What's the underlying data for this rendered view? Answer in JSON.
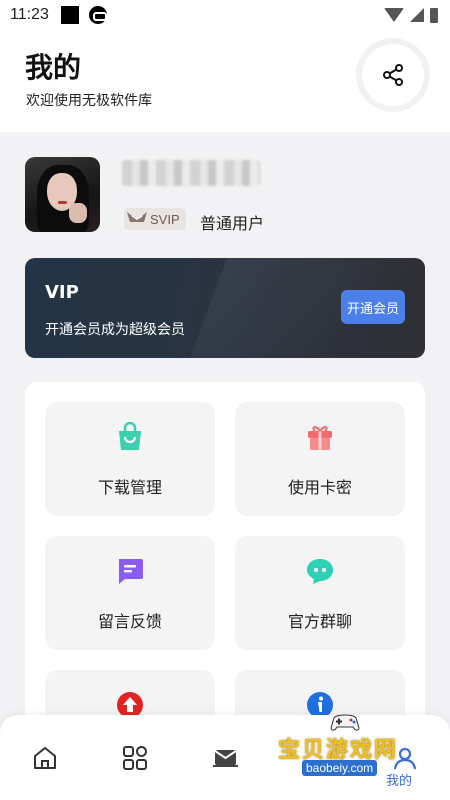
{
  "status_bar": {
    "time": "11:23"
  },
  "header": {
    "title": "我的",
    "subtitle": "欢迎使用无极软件库"
  },
  "profile": {
    "badge_label": "SVIP",
    "user_type": "普通用户"
  },
  "vip_banner": {
    "title": "VIP",
    "description": "开通会员成为超级会员",
    "button_label": "开通会员"
  },
  "grid": {
    "items": [
      {
        "label": "下载管理",
        "icon": "shopping-bag-icon"
      },
      {
        "label": "使用卡密",
        "icon": "gift-icon"
      },
      {
        "label": "留言反馈",
        "icon": "message-icon"
      },
      {
        "label": "官方群聊",
        "icon": "chat-bubble-icon"
      },
      {
        "label": "",
        "icon": "upload-arrow-icon"
      },
      {
        "label": "",
        "icon": "info-icon"
      }
    ]
  },
  "bottom_nav": {
    "items": [
      {
        "icon": "home-icon"
      },
      {
        "icon": "apps-grid-icon"
      },
      {
        "icon": "mail-icon"
      },
      {
        "icon": "profile-icon",
        "label": "我的"
      }
    ]
  },
  "watermark": {
    "text": "宝贝游戏网",
    "url": "baobeiy.com"
  },
  "colors": {
    "accent": "#4a80e8",
    "banner_bg": "#2c3440",
    "active_nav": "#3c6ecf"
  }
}
